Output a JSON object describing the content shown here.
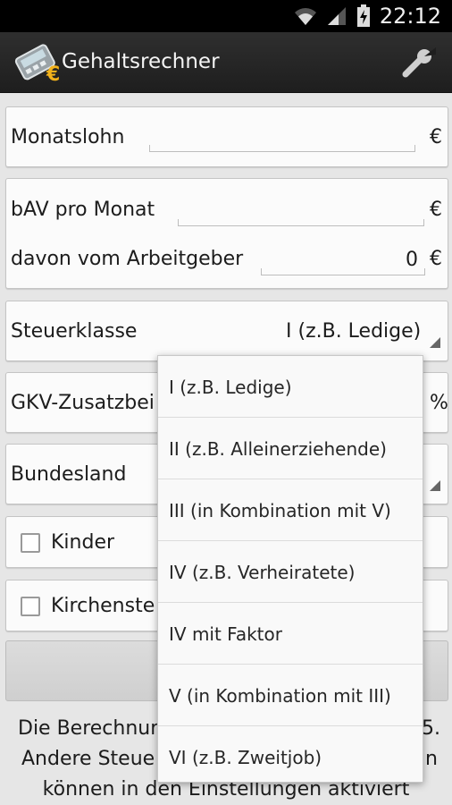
{
  "status_bar": {
    "time": "22:12"
  },
  "app": {
    "title": "Gehaltsrechner"
  },
  "form": {
    "monatslohn": {
      "label": "Monatslohn",
      "value": "",
      "unit": "€"
    },
    "bav": {
      "label": "bAV pro Monat",
      "value": "",
      "unit": "€"
    },
    "arbeitgeber": {
      "label": "davon vom Arbeitgeber",
      "value": "0",
      "unit": "€"
    },
    "steuerklasse": {
      "label": "Steuerklasse",
      "value": "I (z.B. Ledige)"
    },
    "gkv": {
      "label": "GKV-Zusatzbei",
      "unit": "%"
    },
    "bundesland": {
      "label": "Bundesland"
    },
    "kinder": {
      "label": "Kinder",
      "checked": false
    },
    "kirchensteuer": {
      "label": "Kirchenste",
      "checked": false
    }
  },
  "info": {
    "line1_left": "Die Berechnur",
    "line1_right": "5.",
    "line2_left": "Andere Steue",
    "line2_right": "n",
    "line3": "können in den Einstellungen aktiviert"
  },
  "dropdown": {
    "options": [
      "I (z.B. Ledige)",
      "II (z.B. Alleinerziehende)",
      "III (in Kombination mit V)",
      "IV (z.B. Verheiratete)",
      "IV mit Faktor",
      "V (in Kombination mit III)",
      "VI (z.B. Zweitjob)"
    ]
  }
}
